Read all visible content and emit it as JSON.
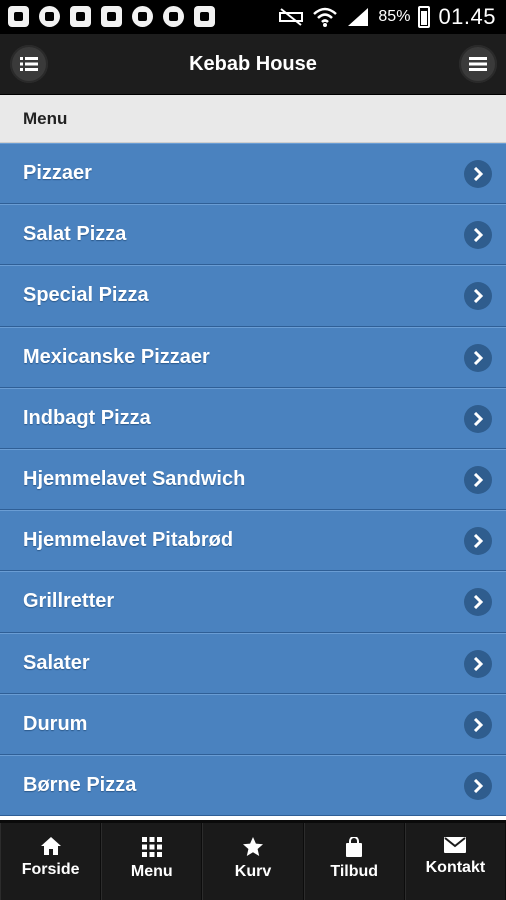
{
  "status_bar": {
    "battery": "85%",
    "time": "01.45",
    "icons": [
      "back-icon",
      "chat-icon",
      "mail-icon",
      "image-icon",
      "walk-icon",
      "sync-icon",
      "android-icon",
      "mute-icon",
      "wifi-icon",
      "signal-icon",
      "battery-icon"
    ]
  },
  "header": {
    "title": "Kebab House",
    "left_icon": "list-icon",
    "right_icon": "hamburger-menu-icon"
  },
  "divider": {
    "label": "Menu"
  },
  "menu_items": [
    {
      "label": "Pizzaer"
    },
    {
      "label": "Salat Pizza"
    },
    {
      "label": "Special Pizza"
    },
    {
      "label": "Mexicanske Pizzaer"
    },
    {
      "label": "Indbagt Pizza"
    },
    {
      "label": "Hjemmelavet Sandwich"
    },
    {
      "label": "Hjemmelavet Pitabrød"
    },
    {
      "label": "Grillretter"
    },
    {
      "label": "Salater"
    },
    {
      "label": "Durum"
    },
    {
      "label": "Børne Pizza"
    }
  ],
  "tabbar": [
    {
      "label": "Forside",
      "icon": "home-icon"
    },
    {
      "label": "Menu",
      "icon": "grid-icon"
    },
    {
      "label": "Kurv",
      "icon": "star-icon"
    },
    {
      "label": "Tilbud",
      "icon": "shopping-bag-icon"
    },
    {
      "label": "Kontakt",
      "icon": "mail-icon"
    }
  ],
  "colors": {
    "list_item_bg": "#4a82bf",
    "header_bg": "#1d1d1d",
    "tabbar_bg": "#1a1a1a",
    "divider_bg": "#e9e9e9"
  }
}
